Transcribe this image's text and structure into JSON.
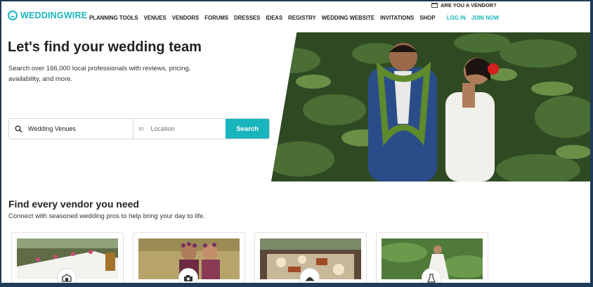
{
  "header": {
    "logo_text": "WEDDINGWIRE",
    "nav": [
      "PLANNING TOOLS",
      "VENUES",
      "VENDORS",
      "FORUMS",
      "DRESSES",
      "IDEAS",
      "REGISTRY",
      "WEDDING WEBSITE",
      "INVITATIONS",
      "SHOP"
    ],
    "vendor_question": "ARE YOU A VENDOR?",
    "login": "LOG IN",
    "join": "JOIN NOW"
  },
  "hero": {
    "title": "Let's find your wedding team",
    "subtitle": "Search over 166,000 local professionals with reviews, pricing, availability, and more.",
    "search_value": "Wedding Venues",
    "in_label": "in",
    "location_placeholder": "Location",
    "search_button": "Search"
  },
  "vendors": {
    "title": "Find every vendor you need",
    "subtitle": "Connect with seasoned wedding pros to help bring your day to life.",
    "cards": [
      {
        "icon": "venue-icon"
      },
      {
        "icon": "camera-icon"
      },
      {
        "icon": "catering-icon"
      },
      {
        "icon": "dress-icon"
      }
    ]
  },
  "colors": {
    "brand": "#19b5bc",
    "frame": "#1f3b57"
  }
}
